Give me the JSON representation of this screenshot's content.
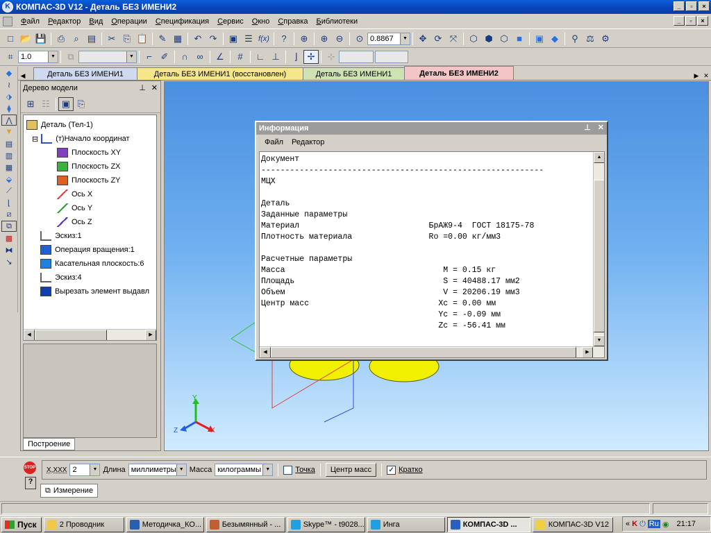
{
  "window": {
    "title": "КОМПАС-3D V12 - Деталь БЕЗ ИМЕНИ2",
    "app_icon": "kompas-logo-icon"
  },
  "menu": [
    "Файл",
    "Редактор",
    "Вид",
    "Операции",
    "Спецификация",
    "Сервис",
    "Окно",
    "Справка",
    "Библиотеки"
  ],
  "toolbar1": {
    "zoom_value": "0.8867"
  },
  "toolbar2": {
    "step_value": "1.0"
  },
  "doc_tabs": [
    {
      "label": "Деталь БЕЗ ИМЕНИ1",
      "color": "#cfd9ef"
    },
    {
      "label": "Деталь БЕЗ ИМЕНИ1 (восстановлен)",
      "color": "#f6e68a"
    },
    {
      "label": "Деталь БЕЗ ИМЕНИ1",
      "color": "#cfe2b4"
    },
    {
      "label": "Деталь БЕЗ ИМЕНИ2",
      "color": "#f2c6c6",
      "active": true
    }
  ],
  "tree": {
    "title": "Дерево модели",
    "nodes": [
      {
        "label": "Деталь (Тел-1)",
        "icon": "part-icon"
      },
      {
        "label": "(т)Начало координат",
        "icon": "origin-icon"
      },
      {
        "label": "Плоскость XY",
        "icon": "plane-xy-icon"
      },
      {
        "label": "Плоскость ZX",
        "icon": "plane-zx-icon"
      },
      {
        "label": "Плоскость ZY",
        "icon": "plane-zy-icon"
      },
      {
        "label": "Ось X",
        "icon": "axis-x-icon"
      },
      {
        "label": "Ось Y",
        "icon": "axis-y-icon"
      },
      {
        "label": "Ось Z",
        "icon": "axis-z-icon"
      },
      {
        "label": "Эскиз:1",
        "icon": "sketch-icon"
      },
      {
        "label": "Операция вращения:1",
        "icon": "revolve-icon"
      },
      {
        "label": "Касательная плоскость:6",
        "icon": "tangent-plane-icon"
      },
      {
        "label": "Эскиз:4",
        "icon": "sketch-icon"
      },
      {
        "label": "Вырезать элемент выдавл",
        "icon": "cut-extrude-icon"
      }
    ],
    "bottom_tab": "Построение"
  },
  "info": {
    "title": "Информация",
    "menu": [
      "Файл",
      "Редактор"
    ],
    "lines": [
      "Документ",
      "-----------------------------------------------------------",
      "МЦХ",
      "",
      "Деталь",
      "Заданные параметры",
      "Материал                           БрАЖ9-4  ГОСТ 18175-78",
      "Плотность материала                Ro =0.00 кг/мм3",
      "",
      "Расчетные параметры",
      "Масса                                 M = 0.15 кг",
      "Площадь                               S = 40488.17 мм2",
      "Объем                                 V = 20206.19 мм3",
      "Центр масс                           Xc = 0.00 мм",
      "                                     Yc = -0.09 мм",
      "                                     Zc = -56.41 мм"
    ]
  },
  "axes": {
    "x": "X",
    "y": "Y",
    "z": "Z"
  },
  "props": {
    "precision_label": "X,XXX",
    "precision_value": "2",
    "length_label": "Длина",
    "length_value": "миллиметры",
    "mass_label": "Масса",
    "mass_value": "килограммы",
    "point_label": "Точка",
    "center_button": "Центр масс",
    "brief_label": "Кратко",
    "brief_checked": true,
    "tab": "Измерение",
    "stop_icon": "STOP"
  },
  "taskbar": {
    "start": "Пуск",
    "buttons": [
      {
        "label": "2 Проводник",
        "icon": "folder-icon",
        "color": "#f0c84a"
      },
      {
        "label": "Методичка_КО...",
        "icon": "word-icon",
        "color": "#2a5fb0"
      },
      {
        "label": "Безымянный - ...",
        "icon": "paint-icon",
        "color": "#c06030"
      },
      {
        "label": "Skype™ - t9028...",
        "icon": "skype-icon",
        "color": "#20a0e0"
      },
      {
        "label": "Инга",
        "icon": "skype-chat-icon",
        "color": "#20a0e0"
      },
      {
        "label": "КОМПАС-3D ...",
        "icon": "kompas-icon",
        "color": "#2a60c0",
        "active": true
      },
      {
        "label": "КОМПАС-3D V12",
        "icon": "kompas-v12-icon",
        "color": "#f0d040"
      }
    ],
    "tray": {
      "lang": "Ru",
      "time": "21:17"
    }
  }
}
